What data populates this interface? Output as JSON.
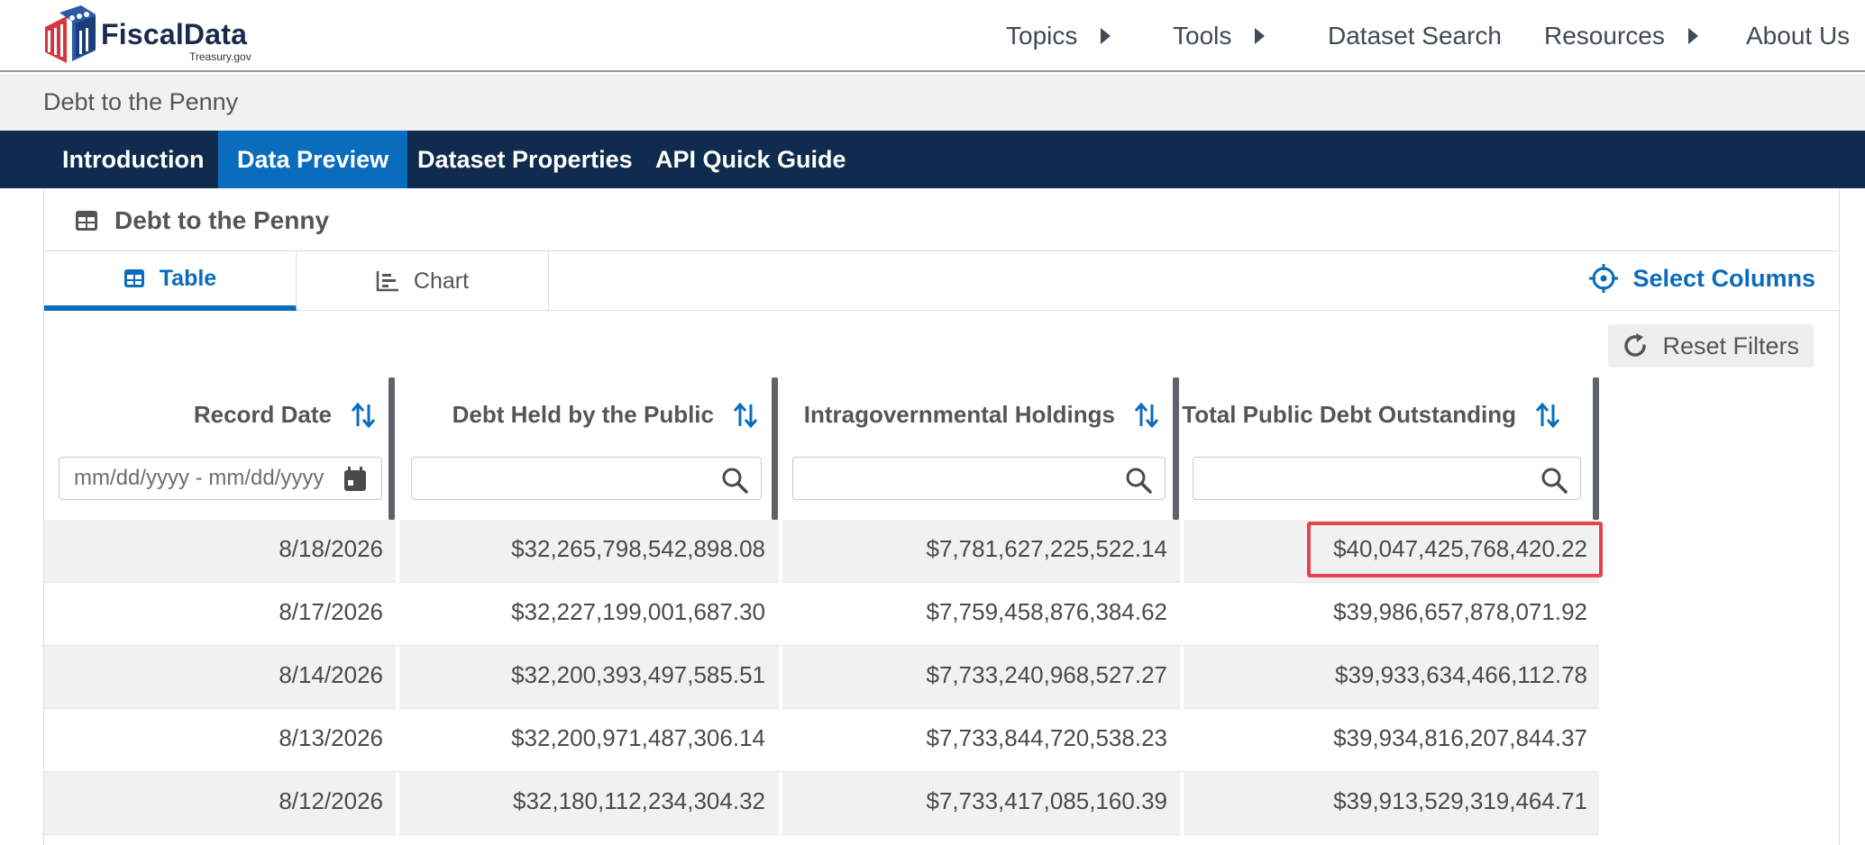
{
  "logo": {
    "name": "FiscalData",
    "sub": "Treasury.gov"
  },
  "nav": [
    {
      "label": "Topics",
      "has_menu": true
    },
    {
      "label": "Tools",
      "has_menu": true
    },
    {
      "label": "Dataset Search",
      "has_menu": false
    },
    {
      "label": "Resources",
      "has_menu": true
    },
    {
      "label": "About Us",
      "has_menu": false
    }
  ],
  "breadcrumb": "Debt to the Penny",
  "dataset_tabs": [
    "Introduction",
    "Data Preview",
    "Dataset Properties",
    "API Quick Guide"
  ],
  "active_dataset_tab": "Data Preview",
  "panel": {
    "title": "Debt to the Penny",
    "view_tabs": [
      "Table",
      "Chart"
    ],
    "active_view": "Table",
    "select_columns_label": "Select Columns",
    "reset_filters_label": "Reset Filters"
  },
  "table": {
    "columns": [
      {
        "label": "Record Date",
        "filter_placeholder": "mm/dd/yyyy - mm/dd/yyyy"
      },
      {
        "label": "Debt Held by the Public",
        "filter_placeholder": ""
      },
      {
        "label": "Intragovernmental Holdings",
        "filter_placeholder": ""
      },
      {
        "label": "Total Public Debt Outstanding",
        "filter_placeholder": ""
      }
    ],
    "rows": [
      [
        "8/18/2026",
        "$32,265,798,542,898.08",
        "$7,781,627,225,522.14",
        "$40,047,425,768,420.22"
      ],
      [
        "8/17/2026",
        "$32,227,199,001,687.30",
        "$7,759,458,876,384.62",
        "$39,986,657,878,071.92"
      ],
      [
        "8/14/2026",
        "$32,200,393,497,585.51",
        "$7,733,240,968,527.27",
        "$39,933,634,466,112.78"
      ],
      [
        "8/13/2026",
        "$32,200,971,487,306.14",
        "$7,733,844,720,538.23",
        "$39,934,816,207,844.37"
      ],
      [
        "8/12/2026",
        "$32,180,112,234,304.32",
        "$7,733,417,085,160.39",
        "$39,913,529,319,464.71"
      ]
    ]
  },
  "colors": {
    "navy": "#0f2b4e",
    "accent_blue": "#0a6cbd",
    "highlight_red": "#e4424d"
  }
}
